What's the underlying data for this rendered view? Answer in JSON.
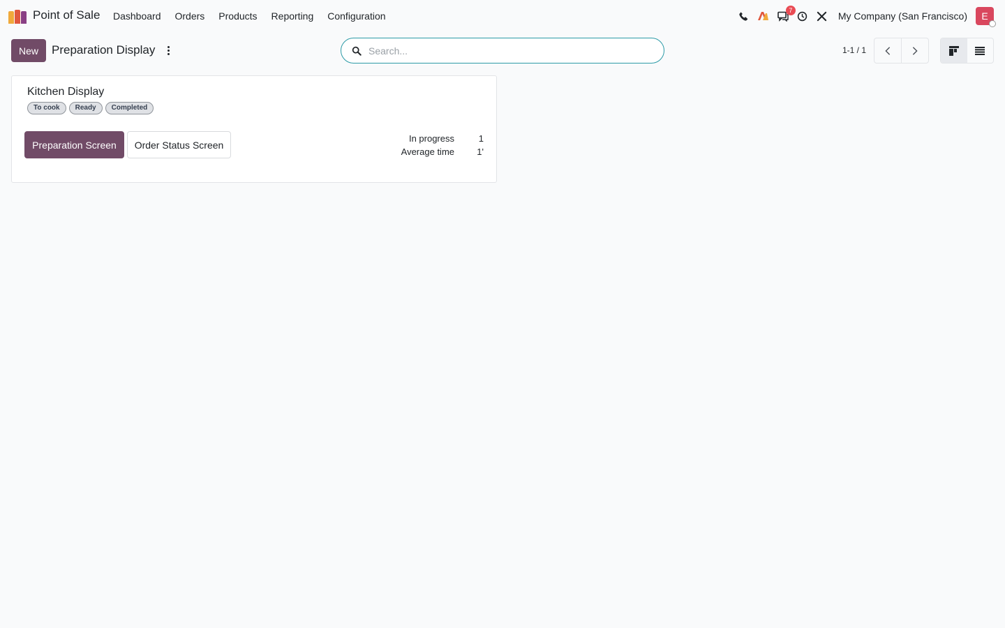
{
  "navbar": {
    "app_title": "Point of Sale",
    "menu": [
      "Dashboard",
      "Orders",
      "Products",
      "Reporting",
      "Configuration"
    ],
    "messages_count": "7",
    "company": "My Company (San Francisco)",
    "avatar_initial": "E",
    "logo_colors": [
      "#f0a93b",
      "#e0583e",
      "#8a3f84"
    ]
  },
  "control_panel": {
    "new_label": "New",
    "title": "Preparation Display",
    "search_placeholder": "Search...",
    "pager": "1-1 / 1"
  },
  "card": {
    "title": "Kitchen Display",
    "tags": [
      "To cook",
      "Ready",
      "Completed"
    ],
    "primary_button": "Preparation Screen",
    "secondary_button": "Order Status Screen",
    "stats": [
      {
        "label": "In progress",
        "value": "1"
      },
      {
        "label": "Average time",
        "value": "1'"
      }
    ]
  },
  "colors": {
    "brand": "#714b67",
    "search_border": "#2b9aa6",
    "badge": "#e94b54",
    "avatar": "#d9475e"
  }
}
